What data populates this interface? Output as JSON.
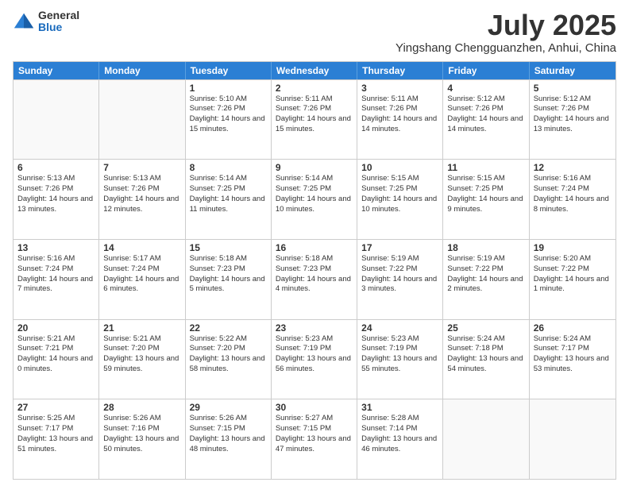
{
  "logo": {
    "general": "General",
    "blue": "Blue"
  },
  "title": "July 2025",
  "subtitle": "Yingshang Chengguanzhen, Anhui, China",
  "header_days": [
    "Sunday",
    "Monday",
    "Tuesday",
    "Wednesday",
    "Thursday",
    "Friday",
    "Saturday"
  ],
  "weeks": [
    [
      {
        "day": "",
        "info": ""
      },
      {
        "day": "",
        "info": ""
      },
      {
        "day": "1",
        "info": "Sunrise: 5:10 AM\nSunset: 7:26 PM\nDaylight: 14 hours and 15 minutes."
      },
      {
        "day": "2",
        "info": "Sunrise: 5:11 AM\nSunset: 7:26 PM\nDaylight: 14 hours and 15 minutes."
      },
      {
        "day": "3",
        "info": "Sunrise: 5:11 AM\nSunset: 7:26 PM\nDaylight: 14 hours and 14 minutes."
      },
      {
        "day": "4",
        "info": "Sunrise: 5:12 AM\nSunset: 7:26 PM\nDaylight: 14 hours and 14 minutes."
      },
      {
        "day": "5",
        "info": "Sunrise: 5:12 AM\nSunset: 7:26 PM\nDaylight: 14 hours and 13 minutes."
      }
    ],
    [
      {
        "day": "6",
        "info": "Sunrise: 5:13 AM\nSunset: 7:26 PM\nDaylight: 14 hours and 13 minutes."
      },
      {
        "day": "7",
        "info": "Sunrise: 5:13 AM\nSunset: 7:26 PM\nDaylight: 14 hours and 12 minutes."
      },
      {
        "day": "8",
        "info": "Sunrise: 5:14 AM\nSunset: 7:25 PM\nDaylight: 14 hours and 11 minutes."
      },
      {
        "day": "9",
        "info": "Sunrise: 5:14 AM\nSunset: 7:25 PM\nDaylight: 14 hours and 10 minutes."
      },
      {
        "day": "10",
        "info": "Sunrise: 5:15 AM\nSunset: 7:25 PM\nDaylight: 14 hours and 10 minutes."
      },
      {
        "day": "11",
        "info": "Sunrise: 5:15 AM\nSunset: 7:25 PM\nDaylight: 14 hours and 9 minutes."
      },
      {
        "day": "12",
        "info": "Sunrise: 5:16 AM\nSunset: 7:24 PM\nDaylight: 14 hours and 8 minutes."
      }
    ],
    [
      {
        "day": "13",
        "info": "Sunrise: 5:16 AM\nSunset: 7:24 PM\nDaylight: 14 hours and 7 minutes."
      },
      {
        "day": "14",
        "info": "Sunrise: 5:17 AM\nSunset: 7:24 PM\nDaylight: 14 hours and 6 minutes."
      },
      {
        "day": "15",
        "info": "Sunrise: 5:18 AM\nSunset: 7:23 PM\nDaylight: 14 hours and 5 minutes."
      },
      {
        "day": "16",
        "info": "Sunrise: 5:18 AM\nSunset: 7:23 PM\nDaylight: 14 hours and 4 minutes."
      },
      {
        "day": "17",
        "info": "Sunrise: 5:19 AM\nSunset: 7:22 PM\nDaylight: 14 hours and 3 minutes."
      },
      {
        "day": "18",
        "info": "Sunrise: 5:19 AM\nSunset: 7:22 PM\nDaylight: 14 hours and 2 minutes."
      },
      {
        "day": "19",
        "info": "Sunrise: 5:20 AM\nSunset: 7:22 PM\nDaylight: 14 hours and 1 minute."
      }
    ],
    [
      {
        "day": "20",
        "info": "Sunrise: 5:21 AM\nSunset: 7:21 PM\nDaylight: 14 hours and 0 minutes."
      },
      {
        "day": "21",
        "info": "Sunrise: 5:21 AM\nSunset: 7:20 PM\nDaylight: 13 hours and 59 minutes."
      },
      {
        "day": "22",
        "info": "Sunrise: 5:22 AM\nSunset: 7:20 PM\nDaylight: 13 hours and 58 minutes."
      },
      {
        "day": "23",
        "info": "Sunrise: 5:23 AM\nSunset: 7:19 PM\nDaylight: 13 hours and 56 minutes."
      },
      {
        "day": "24",
        "info": "Sunrise: 5:23 AM\nSunset: 7:19 PM\nDaylight: 13 hours and 55 minutes."
      },
      {
        "day": "25",
        "info": "Sunrise: 5:24 AM\nSunset: 7:18 PM\nDaylight: 13 hours and 54 minutes."
      },
      {
        "day": "26",
        "info": "Sunrise: 5:24 AM\nSunset: 7:17 PM\nDaylight: 13 hours and 53 minutes."
      }
    ],
    [
      {
        "day": "27",
        "info": "Sunrise: 5:25 AM\nSunset: 7:17 PM\nDaylight: 13 hours and 51 minutes."
      },
      {
        "day": "28",
        "info": "Sunrise: 5:26 AM\nSunset: 7:16 PM\nDaylight: 13 hours and 50 minutes."
      },
      {
        "day": "29",
        "info": "Sunrise: 5:26 AM\nSunset: 7:15 PM\nDaylight: 13 hours and 48 minutes."
      },
      {
        "day": "30",
        "info": "Sunrise: 5:27 AM\nSunset: 7:15 PM\nDaylight: 13 hours and 47 minutes."
      },
      {
        "day": "31",
        "info": "Sunrise: 5:28 AM\nSunset: 7:14 PM\nDaylight: 13 hours and 46 minutes."
      },
      {
        "day": "",
        "info": ""
      },
      {
        "day": "",
        "info": ""
      }
    ]
  ]
}
